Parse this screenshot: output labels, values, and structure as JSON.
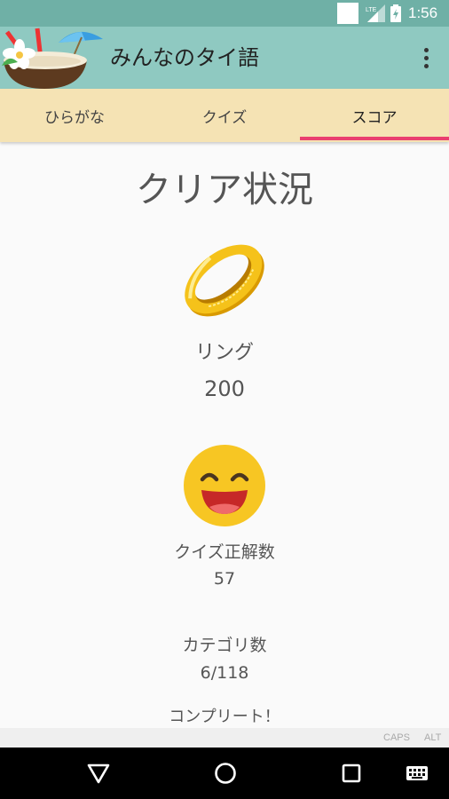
{
  "status_bar": {
    "network_type": "LTE",
    "time": "1:56"
  },
  "app_bar": {
    "logo_icon": "coconut-drink-icon",
    "title": "みんなのタイ語",
    "menu_icon": "more-vert-icon"
  },
  "tabs": [
    {
      "label": "ひらがな",
      "selected": false
    },
    {
      "label": "クイズ",
      "selected": false
    },
    {
      "label": "スコア",
      "selected": true
    }
  ],
  "score": {
    "heading": "クリア状況",
    "ring": {
      "icon": "gold-ring-icon",
      "label": "リング",
      "value": "200"
    },
    "quiz": {
      "icon": "smiling-face-icon",
      "label": "クイズ正解数",
      "value": "57"
    },
    "category": {
      "label": "カテゴリ数",
      "value": "6/118"
    },
    "complete_label": "コンプリート！"
  },
  "key_strip": {
    "caps": "CAPS",
    "alt": "ALT"
  },
  "nav_bar": {
    "back_icon": "back-triangle-icon",
    "home_icon": "home-circle-icon",
    "recents_icon": "recents-square-icon",
    "keyboard_icon": "keyboard-icon"
  },
  "colors": {
    "status_bar": "#6fb0a6",
    "app_bar": "#8fc9c1",
    "tab_bar": "#f5e3b4",
    "tab_indicator": "#ea3f6f",
    "background": "#fafafa"
  }
}
